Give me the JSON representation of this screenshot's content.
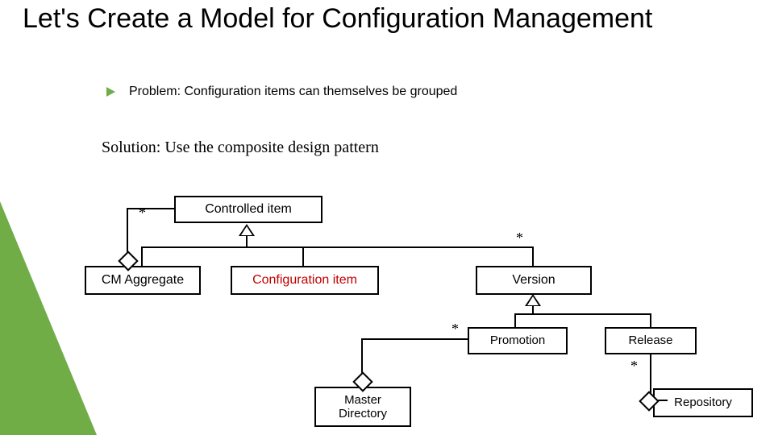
{
  "title": "Let's Create a Model for Configuration Management",
  "problem": "Problem: Configuration items can themselves be grouped",
  "solution": "Solution: Use the composite design pattern",
  "boxes": {
    "controlled_item": "Controlled item",
    "cm_aggregate": "CM Aggregate",
    "configuration_item": "Configuration item",
    "version": "Version",
    "promotion": "Promotion",
    "release": "Release",
    "master_directory": "Master\nDirectory",
    "repository": "Repository"
  },
  "mult": {
    "agg_controlled": "*",
    "controlled_version": "*",
    "promo_master": "*",
    "release_repo": "*"
  },
  "colors": {
    "accent": "#70AD47",
    "ci_text": "#C00000"
  }
}
